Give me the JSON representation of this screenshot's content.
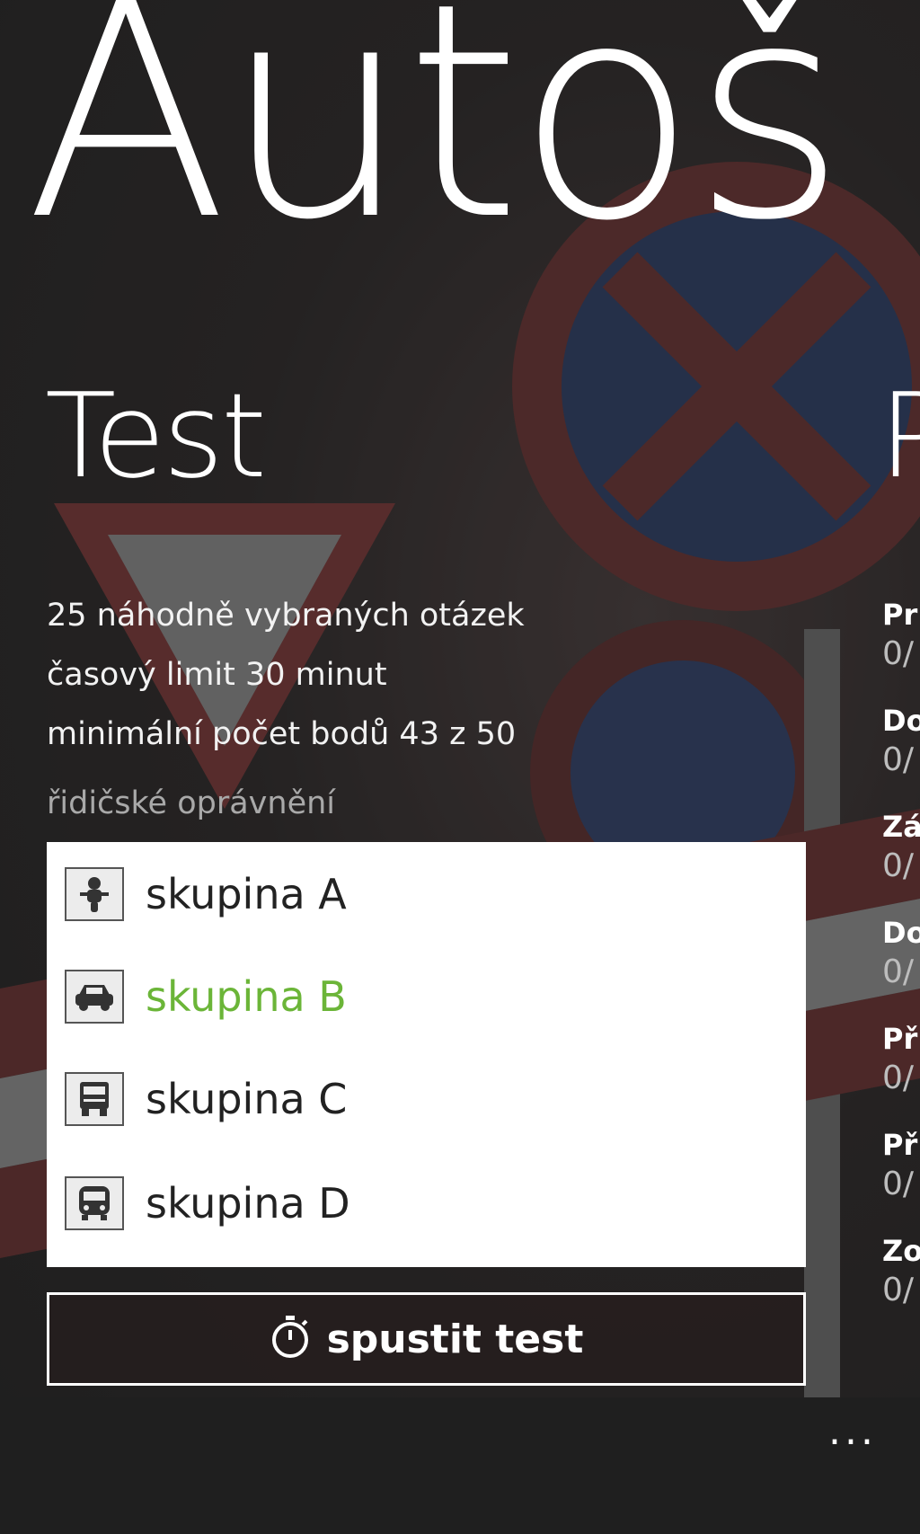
{
  "app_title": "Autoš",
  "pivot": {
    "current": "Test",
    "next_peek": "P"
  },
  "info_lines": [
    "25 náhodně vybraných otázek",
    "časový limit 30 minut",
    "minimální počet bodů 43 z 50"
  ],
  "permission_label": "řidičské oprávnění",
  "options": [
    {
      "label": "skupina A",
      "icon": "motorcycle-icon",
      "selected": false
    },
    {
      "label": "skupina B",
      "icon": "car-icon",
      "selected": true
    },
    {
      "label": "skupina C",
      "icon": "truck-icon",
      "selected": false
    },
    {
      "label": "skupina D",
      "icon": "bus-icon",
      "selected": false
    }
  ],
  "start_button": {
    "label": "spustit test",
    "icon": "stopwatch-icon"
  },
  "right_peek": [
    {
      "title": "Pr",
      "score": "0/"
    },
    {
      "title": "Do",
      "score": "0/"
    },
    {
      "title": "Zá",
      "score": "0/"
    },
    {
      "title": "Do",
      "score": "0/"
    },
    {
      "title": "Př",
      "score": "0/"
    },
    {
      "title": "Př",
      "score": "0/"
    },
    {
      "title": "Zo",
      "score": "0/"
    }
  ],
  "app_bar": {
    "more": "..."
  },
  "colors": {
    "selected_accent": "#6bb538",
    "list_background": "#ffffff"
  }
}
